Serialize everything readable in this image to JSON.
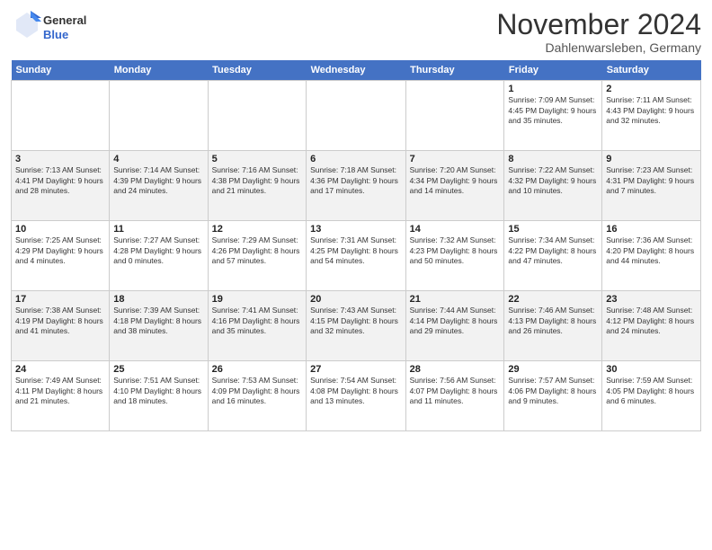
{
  "header": {
    "logo_general": "General",
    "logo_blue": "Blue",
    "month_title": "November 2024",
    "subtitle": "Dahlenwarsleben, Germany"
  },
  "columns": [
    "Sunday",
    "Monday",
    "Tuesday",
    "Wednesday",
    "Thursday",
    "Friday",
    "Saturday"
  ],
  "weeks": [
    [
      {
        "day": "",
        "info": ""
      },
      {
        "day": "",
        "info": ""
      },
      {
        "day": "",
        "info": ""
      },
      {
        "day": "",
        "info": ""
      },
      {
        "day": "",
        "info": ""
      },
      {
        "day": "1",
        "info": "Sunrise: 7:09 AM\nSunset: 4:45 PM\nDaylight: 9 hours and 35 minutes."
      },
      {
        "day": "2",
        "info": "Sunrise: 7:11 AM\nSunset: 4:43 PM\nDaylight: 9 hours and 32 minutes."
      }
    ],
    [
      {
        "day": "3",
        "info": "Sunrise: 7:13 AM\nSunset: 4:41 PM\nDaylight: 9 hours and 28 minutes."
      },
      {
        "day": "4",
        "info": "Sunrise: 7:14 AM\nSunset: 4:39 PM\nDaylight: 9 hours and 24 minutes."
      },
      {
        "day": "5",
        "info": "Sunrise: 7:16 AM\nSunset: 4:38 PM\nDaylight: 9 hours and 21 minutes."
      },
      {
        "day": "6",
        "info": "Sunrise: 7:18 AM\nSunset: 4:36 PM\nDaylight: 9 hours and 17 minutes."
      },
      {
        "day": "7",
        "info": "Sunrise: 7:20 AM\nSunset: 4:34 PM\nDaylight: 9 hours and 14 minutes."
      },
      {
        "day": "8",
        "info": "Sunrise: 7:22 AM\nSunset: 4:32 PM\nDaylight: 9 hours and 10 minutes."
      },
      {
        "day": "9",
        "info": "Sunrise: 7:23 AM\nSunset: 4:31 PM\nDaylight: 9 hours and 7 minutes."
      }
    ],
    [
      {
        "day": "10",
        "info": "Sunrise: 7:25 AM\nSunset: 4:29 PM\nDaylight: 9 hours and 4 minutes."
      },
      {
        "day": "11",
        "info": "Sunrise: 7:27 AM\nSunset: 4:28 PM\nDaylight: 9 hours and 0 minutes."
      },
      {
        "day": "12",
        "info": "Sunrise: 7:29 AM\nSunset: 4:26 PM\nDaylight: 8 hours and 57 minutes."
      },
      {
        "day": "13",
        "info": "Sunrise: 7:31 AM\nSunset: 4:25 PM\nDaylight: 8 hours and 54 minutes."
      },
      {
        "day": "14",
        "info": "Sunrise: 7:32 AM\nSunset: 4:23 PM\nDaylight: 8 hours and 50 minutes."
      },
      {
        "day": "15",
        "info": "Sunrise: 7:34 AM\nSunset: 4:22 PM\nDaylight: 8 hours and 47 minutes."
      },
      {
        "day": "16",
        "info": "Sunrise: 7:36 AM\nSunset: 4:20 PM\nDaylight: 8 hours and 44 minutes."
      }
    ],
    [
      {
        "day": "17",
        "info": "Sunrise: 7:38 AM\nSunset: 4:19 PM\nDaylight: 8 hours and 41 minutes."
      },
      {
        "day": "18",
        "info": "Sunrise: 7:39 AM\nSunset: 4:18 PM\nDaylight: 8 hours and 38 minutes."
      },
      {
        "day": "19",
        "info": "Sunrise: 7:41 AM\nSunset: 4:16 PM\nDaylight: 8 hours and 35 minutes."
      },
      {
        "day": "20",
        "info": "Sunrise: 7:43 AM\nSunset: 4:15 PM\nDaylight: 8 hours and 32 minutes."
      },
      {
        "day": "21",
        "info": "Sunrise: 7:44 AM\nSunset: 4:14 PM\nDaylight: 8 hours and 29 minutes."
      },
      {
        "day": "22",
        "info": "Sunrise: 7:46 AM\nSunset: 4:13 PM\nDaylight: 8 hours and 26 minutes."
      },
      {
        "day": "23",
        "info": "Sunrise: 7:48 AM\nSunset: 4:12 PM\nDaylight: 8 hours and 24 minutes."
      }
    ],
    [
      {
        "day": "24",
        "info": "Sunrise: 7:49 AM\nSunset: 4:11 PM\nDaylight: 8 hours and 21 minutes."
      },
      {
        "day": "25",
        "info": "Sunrise: 7:51 AM\nSunset: 4:10 PM\nDaylight: 8 hours and 18 minutes."
      },
      {
        "day": "26",
        "info": "Sunrise: 7:53 AM\nSunset: 4:09 PM\nDaylight: 8 hours and 16 minutes."
      },
      {
        "day": "27",
        "info": "Sunrise: 7:54 AM\nSunset: 4:08 PM\nDaylight: 8 hours and 13 minutes."
      },
      {
        "day": "28",
        "info": "Sunrise: 7:56 AM\nSunset: 4:07 PM\nDaylight: 8 hours and 11 minutes."
      },
      {
        "day": "29",
        "info": "Sunrise: 7:57 AM\nSunset: 4:06 PM\nDaylight: 8 hours and 9 minutes."
      },
      {
        "day": "30",
        "info": "Sunrise: 7:59 AM\nSunset: 4:05 PM\nDaylight: 8 hours and 6 minutes."
      }
    ]
  ]
}
